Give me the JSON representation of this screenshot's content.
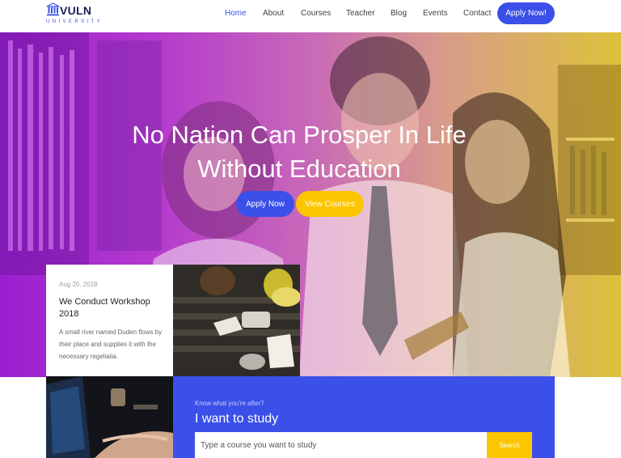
{
  "brand": {
    "name": "VULN",
    "sub": "UNIVERSITY"
  },
  "nav": {
    "items": [
      {
        "label": "Home",
        "active": true
      },
      {
        "label": "About"
      },
      {
        "label": "Courses"
      },
      {
        "label": "Teacher"
      },
      {
        "label": "Blog"
      },
      {
        "label": "Events"
      },
      {
        "label": "Contact"
      }
    ],
    "apply_label": "Apply Now!"
  },
  "hero": {
    "title": "No Nation Can Prosper In Life Without Education",
    "apply_label": "Apply Now",
    "courses_label": "View Courses"
  },
  "event": {
    "date": "Aug 20, 2018",
    "title": "We Conduct Workshop 2018",
    "description": "A small river named Duden flows by their place and supplies it with the necessary regelialia."
  },
  "study": {
    "kicker": "Know what you're after?",
    "title": "I want to study",
    "placeholder": "Type a course you want to study",
    "search_label": "Search"
  },
  "colors": {
    "accent": "#3b50e8",
    "secondary": "#fbc500",
    "brand_dark": "#1c2260"
  },
  "icons": {
    "logo": "university-building-icon"
  }
}
